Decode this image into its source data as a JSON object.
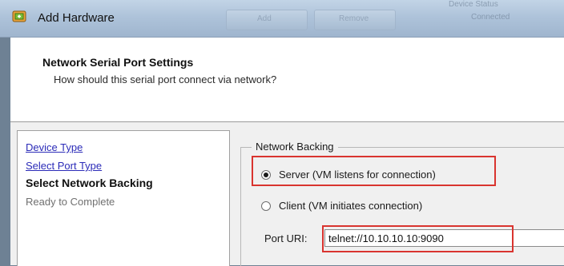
{
  "window": {
    "title": "Add Hardware",
    "bg_tab_labels": [
      "Add",
      "Remove",
      "Device Status",
      "Connected"
    ]
  },
  "header": {
    "title": "Network Serial Port Settings",
    "subtitle": "How should this serial port connect via network?"
  },
  "nav": {
    "items": [
      {
        "label": "Device Type",
        "state": "link"
      },
      {
        "label": "Select Port Type",
        "state": "link"
      },
      {
        "label": "Select Network Backing",
        "state": "current"
      },
      {
        "label": "Ready to Complete",
        "state": "future"
      }
    ]
  },
  "network_backing": {
    "legend": "Network Backing",
    "server_label": "Server (VM listens for connection)",
    "server_selected": true,
    "client_label": "Client  (VM initiates connection)",
    "client_selected": false,
    "port_uri_label": "Port URI:",
    "port_uri_value": "telnet://10.10.10.10:9090"
  },
  "colors": {
    "highlight": "#d9342f",
    "link": "#2b2bb8",
    "titlebar": "#aec3da"
  }
}
